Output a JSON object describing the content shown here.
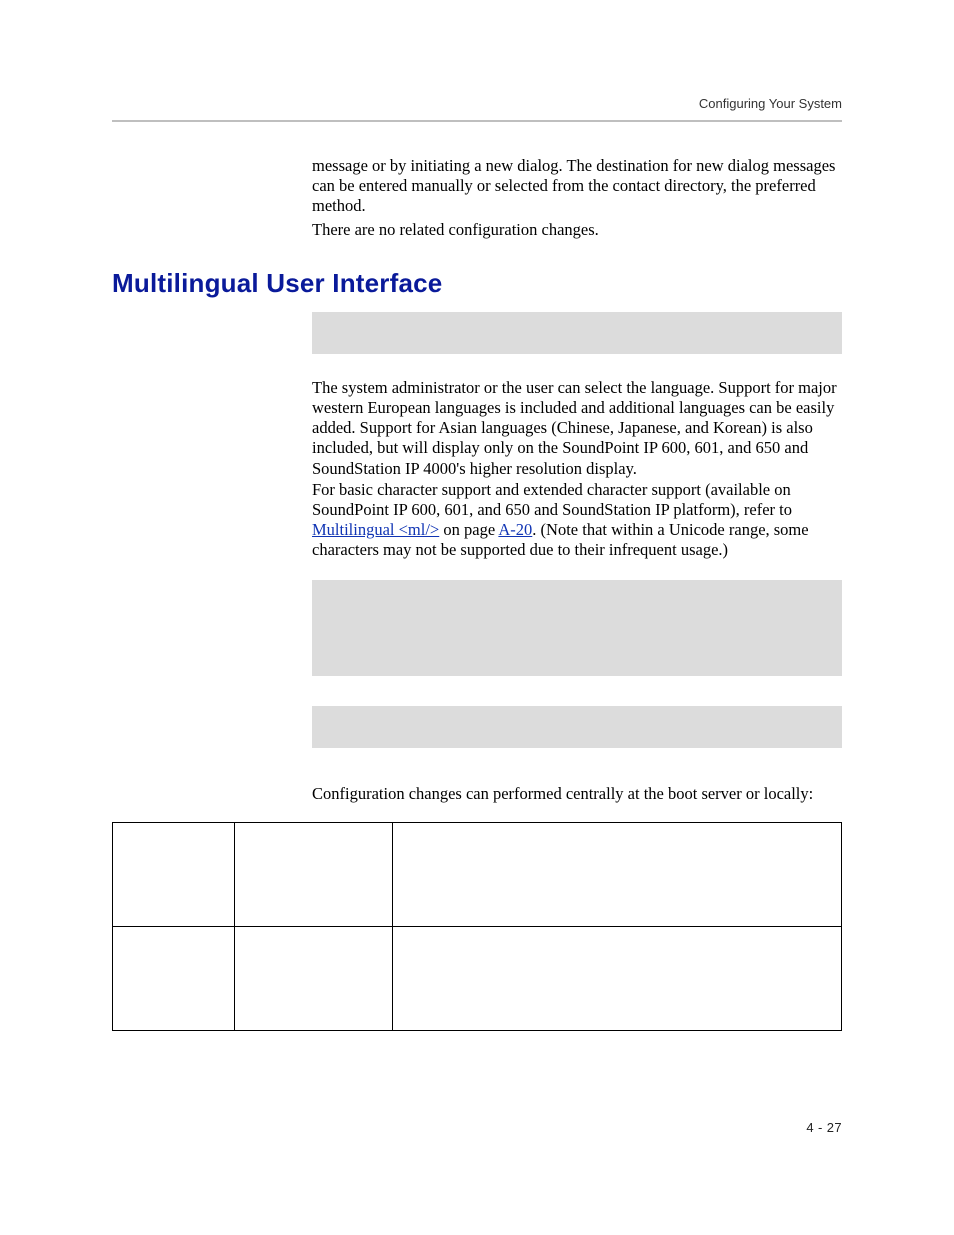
{
  "header": {
    "running_head": "Configuring Your System"
  },
  "content": {
    "intro_para_1": "message or by initiating a new dialog. The destination for new dialog messages can be entered manually or selected from the contact directory, the preferred method.",
    "intro_para_2": "There are no related configuration changes.",
    "heading": "Multilingual User Interface",
    "para_3": "The system administrator or the user can select the language. Support for major western European languages is included and additional languages can be easily added. Support for Asian languages (Chinese, Japanese, and Korean) is also included, but will display only on the SoundPoint IP 600, 601, and 650 and SoundStation IP 4000's higher resolution display.",
    "para_4_before": "For basic character support and extended character support (available on SoundPoint IP 600, 601, and 650 and SoundStation IP platform), refer to ",
    "para_4_link1": "Multilingual <ml/>",
    "para_4_mid": " on page ",
    "para_4_link2": "A-20",
    "para_4_after": ". (Note that within a Unicode range, some characters may not be supported due to their infrequent usage.)",
    "para_5": "Configuration changes can performed centrally at the boot server or locally:"
  },
  "footer": {
    "page_number": "4 - 27"
  }
}
